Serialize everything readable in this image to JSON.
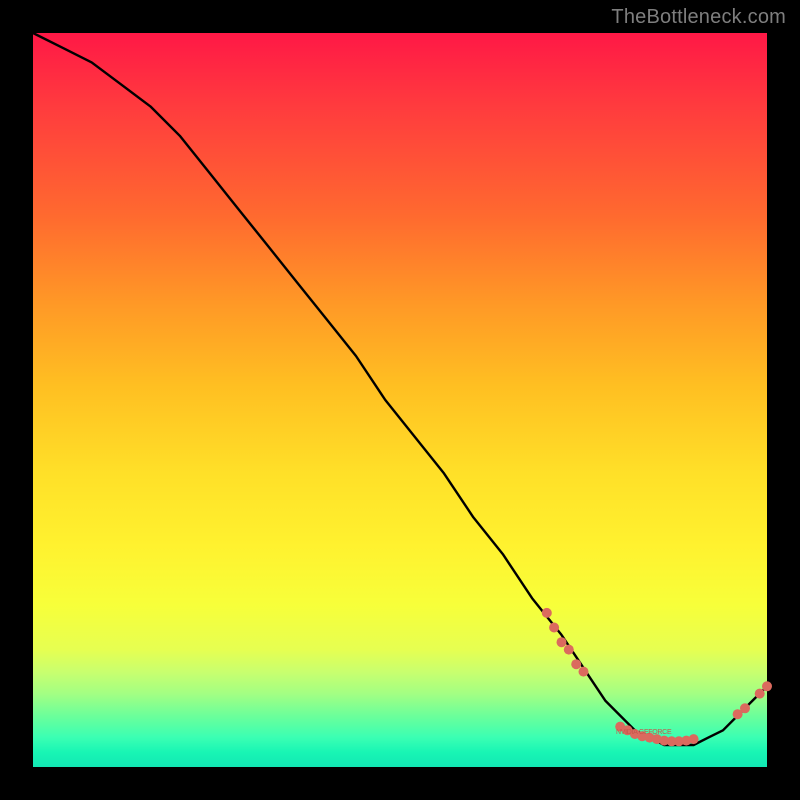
{
  "watermark": "TheBottleneck.com",
  "annotation_label": "NVIDIA GEFORCE",
  "chart_data": {
    "type": "line",
    "title": "",
    "xlabel": "",
    "ylabel": "",
    "xlim": [
      0,
      100
    ],
    "ylim": [
      0,
      100
    ],
    "grid": false,
    "legend": false,
    "series": [
      {
        "name": "bottleneck-curve",
        "color": "#000000",
        "x": [
          0,
          4,
          8,
          12,
          16,
          20,
          24,
          28,
          32,
          36,
          40,
          44,
          48,
          52,
          56,
          60,
          64,
          68,
          72,
          74,
          76,
          78,
          80,
          82,
          84,
          86,
          88,
          90,
          92,
          94,
          96,
          98,
          100
        ],
        "y": [
          100,
          98,
          96,
          93,
          90,
          86,
          81,
          76,
          71,
          66,
          61,
          56,
          50,
          45,
          40,
          34,
          29,
          23,
          18,
          15,
          12,
          9,
          7,
          5,
          4,
          3,
          3,
          3,
          4,
          5,
          7,
          9,
          11
        ]
      }
    ],
    "marker_clusters": [
      {
        "name": "descending-cluster",
        "color": "#db6a5e",
        "points": [
          {
            "x": 70,
            "y": 21
          },
          {
            "x": 71,
            "y": 19
          },
          {
            "x": 72,
            "y": 17
          },
          {
            "x": 73,
            "y": 16
          },
          {
            "x": 74,
            "y": 14
          },
          {
            "x": 75,
            "y": 13
          }
        ]
      },
      {
        "name": "trough-cluster",
        "color": "#db6a5e",
        "points": [
          {
            "x": 80,
            "y": 5.5
          },
          {
            "x": 81,
            "y": 5.0
          },
          {
            "x": 82,
            "y": 4.5
          },
          {
            "x": 83,
            "y": 4.2
          },
          {
            "x": 84,
            "y": 4.0
          },
          {
            "x": 85,
            "y": 3.8
          },
          {
            "x": 86,
            "y": 3.6
          },
          {
            "x": 87,
            "y": 3.5
          },
          {
            "x": 88,
            "y": 3.5
          },
          {
            "x": 89,
            "y": 3.6
          },
          {
            "x": 90,
            "y": 3.8
          }
        ]
      },
      {
        "name": "ascending-cluster",
        "color": "#db6a5e",
        "points": [
          {
            "x": 96,
            "y": 7.2
          },
          {
            "x": 97,
            "y": 8.0
          },
          {
            "x": 99,
            "y": 10.0
          },
          {
            "x": 100,
            "y": 11.0
          }
        ]
      }
    ]
  }
}
